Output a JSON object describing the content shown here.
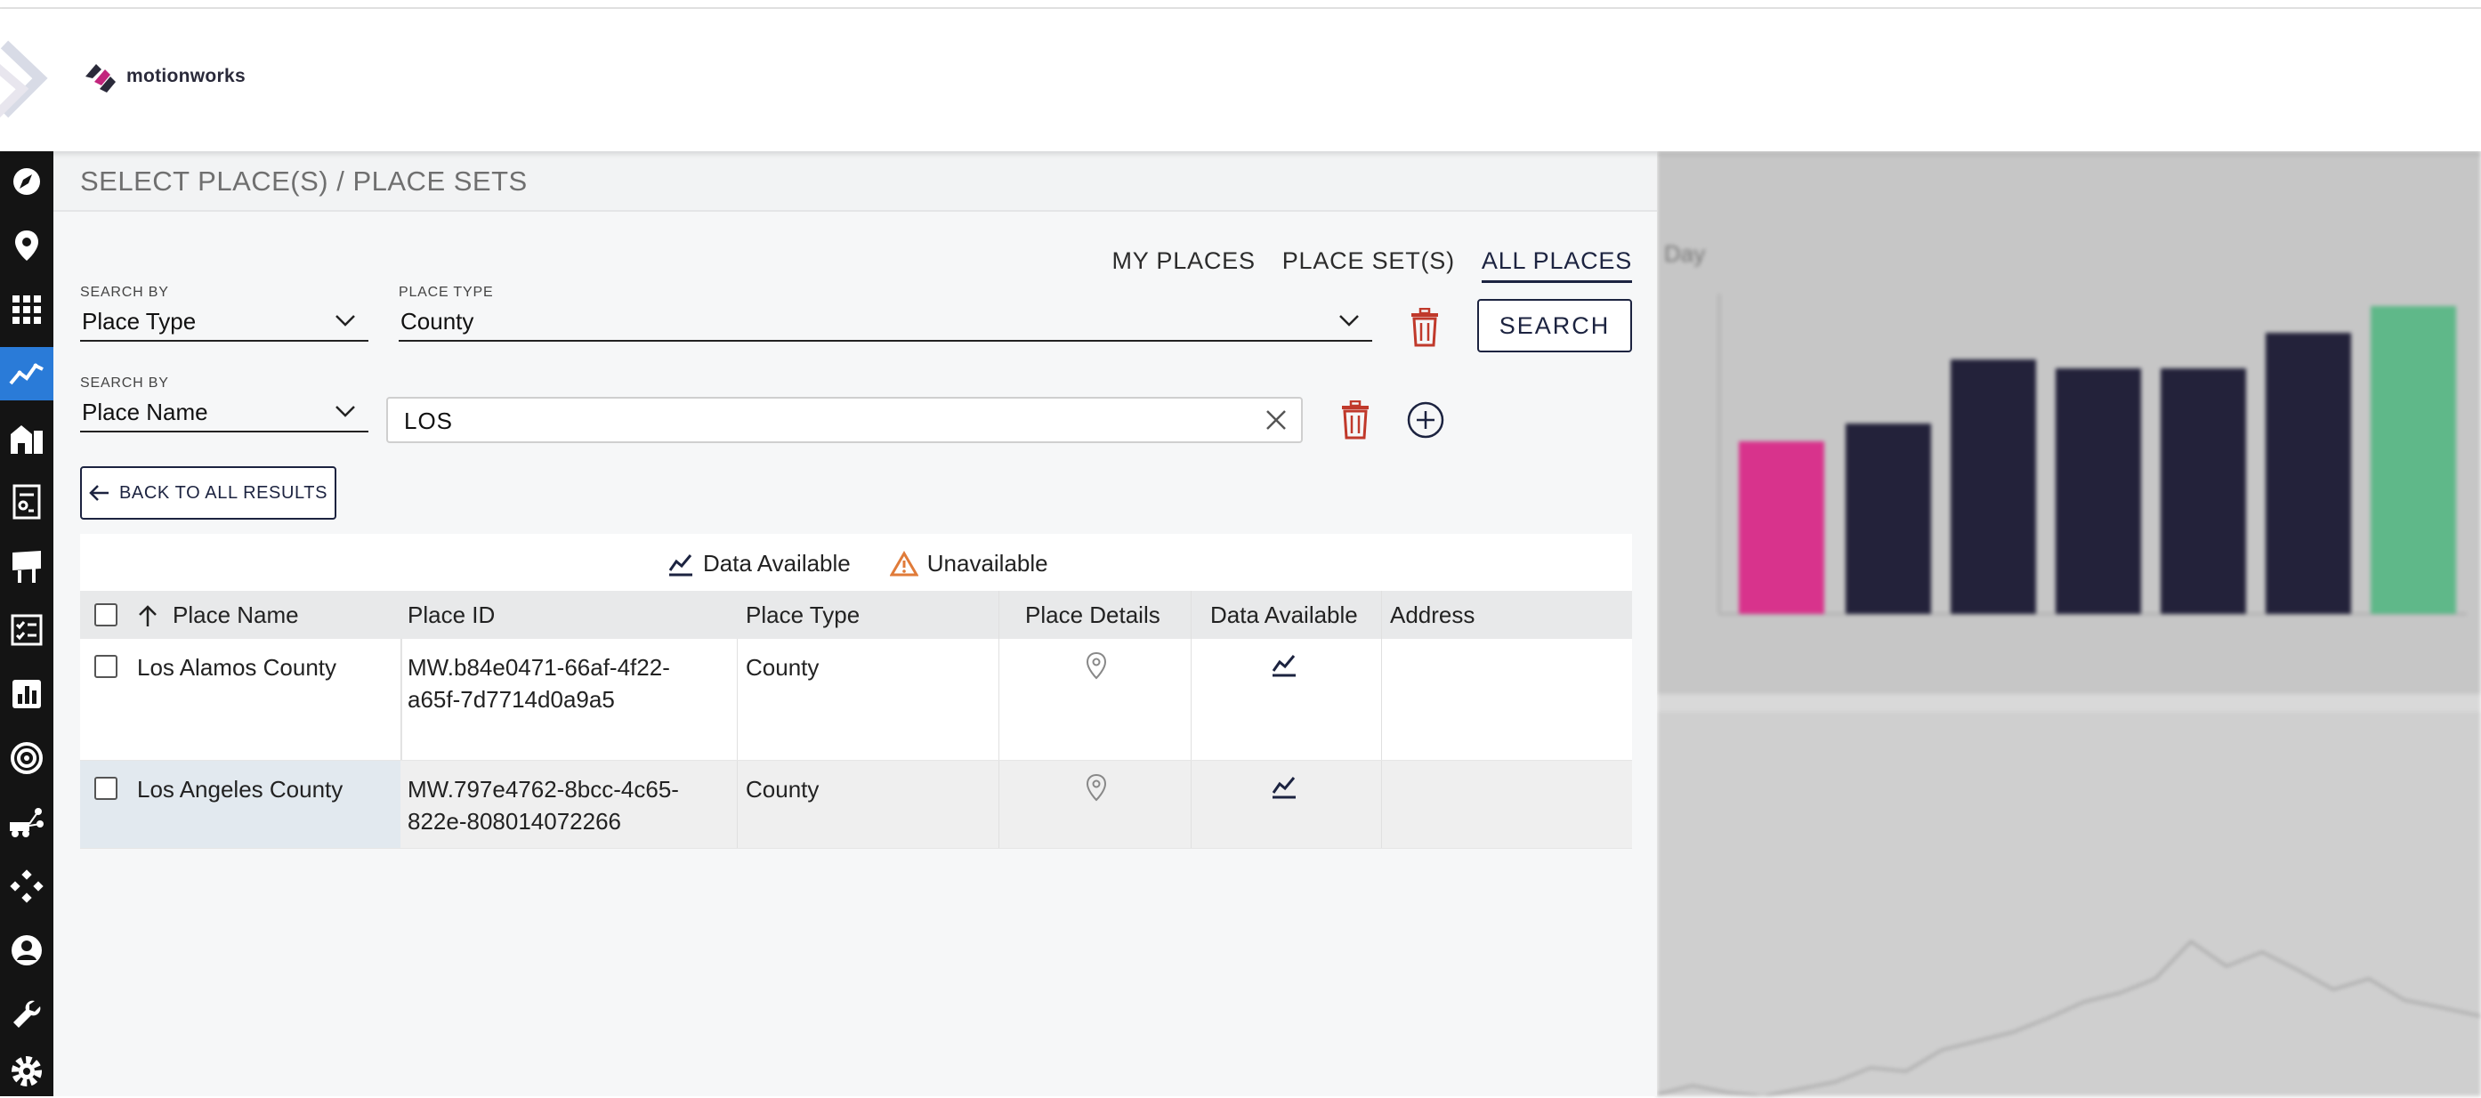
{
  "brand": {
    "name": "motionworks"
  },
  "sidebar": {
    "items": [
      {
        "icon": "compass-icon"
      },
      {
        "icon": "map-pin-icon"
      },
      {
        "icon": "grid-icon"
      },
      {
        "icon": "trend-icon",
        "active": true
      },
      {
        "icon": "buildings-icon"
      },
      {
        "icon": "report-icon"
      },
      {
        "icon": "billboard-icon"
      },
      {
        "icon": "checklist-icon"
      },
      {
        "icon": "bar-chart-icon"
      },
      {
        "icon": "target-icon"
      },
      {
        "icon": "network-icon"
      },
      {
        "icon": "nodes-icon"
      },
      {
        "icon": "user-icon"
      },
      {
        "icon": "wrench-icon"
      },
      {
        "icon": "gear-icon"
      }
    ]
  },
  "panel": {
    "title": "SELECT PLACE(S) / PLACE SETS"
  },
  "tabs": [
    {
      "label": "MY PLACES",
      "active": false
    },
    {
      "label": "PLACE SET(S)",
      "active": false
    },
    {
      "label": "ALL PLACES",
      "active": true
    }
  ],
  "filters": {
    "row1": {
      "search_by_label": "SEARCH BY",
      "search_by_value": "Place Type",
      "type_label": "PLACE TYPE",
      "type_value": "County"
    },
    "row2": {
      "search_by_label": "SEARCH BY",
      "search_by_value": "Place Name",
      "input_value": "LOS"
    }
  },
  "buttons": {
    "search": "SEARCH",
    "back": "BACK TO ALL RESULTS"
  },
  "legend": {
    "available": "Data Available",
    "unavailable": "Unavailable"
  },
  "table": {
    "columns": [
      "Place Name",
      "Place ID",
      "Place Type",
      "Place Details",
      "Data Available",
      "Address"
    ],
    "rows": [
      {
        "name": "Los Alamos County",
        "id_line1": "MW.b84e0471-66af-4f22-",
        "id_line2": "a65f-7d7714d0a9a5",
        "type": "County",
        "address": ""
      },
      {
        "name": "Los Angeles County",
        "id_line1": "MW.797e4762-8bcc-4c65-",
        "id_line2": "822e-808014072266",
        "type": "County",
        "address": ""
      }
    ]
  },
  "colors": {
    "accent": "#1c2340",
    "danger": "#c0392b",
    "warning": "#e07b39",
    "sidebar_active": "#2a7bd8"
  }
}
